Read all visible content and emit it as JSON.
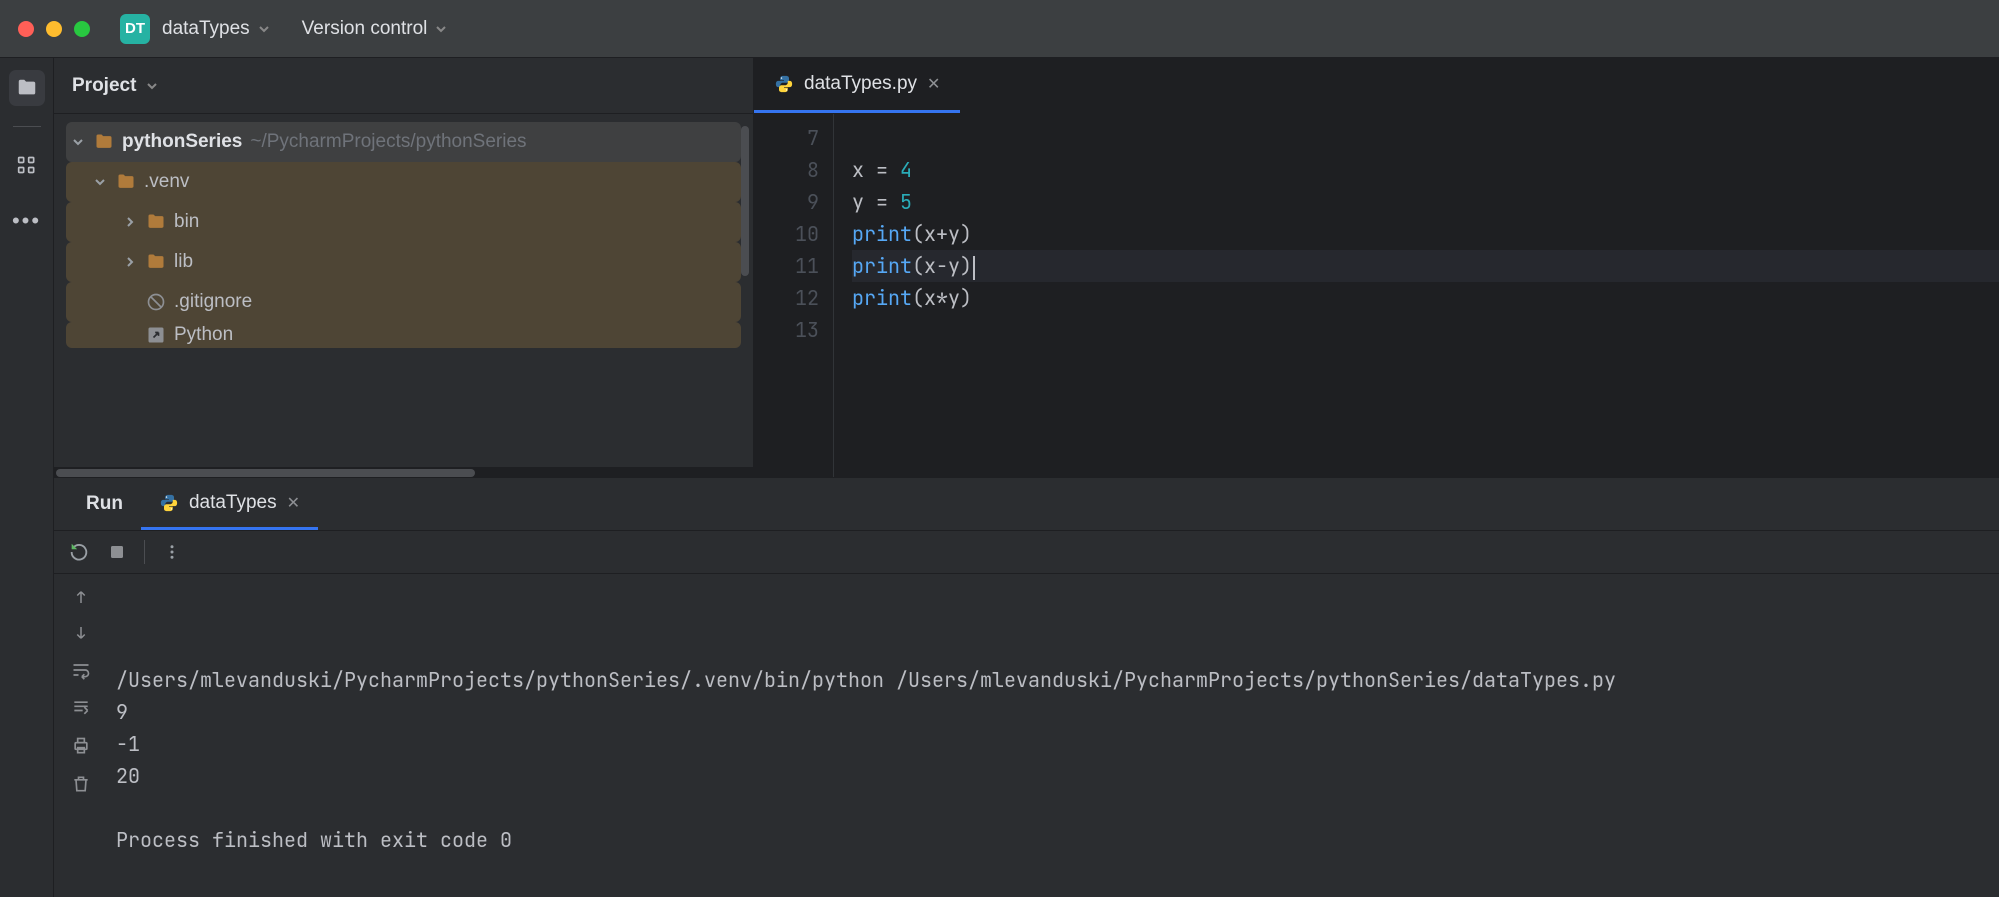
{
  "titlebar": {
    "badge_text": "DT",
    "project_name": "dataTypes",
    "menu_version_control": "Version control"
  },
  "toolstrip": {
    "items": [
      "project-tool",
      "structure-tool",
      "more-tool"
    ]
  },
  "project_panel": {
    "title": "Project",
    "tree": {
      "root_name": "pythonSeries",
      "root_path": "~/PycharmProjects/pythonSeries",
      "items": [
        {
          "name": ".venv",
          "kind": "folder",
          "level": 1,
          "expanded": true
        },
        {
          "name": "bin",
          "kind": "folder",
          "level": 2,
          "expanded": false
        },
        {
          "name": "lib",
          "kind": "folder",
          "level": 2,
          "expanded": false
        },
        {
          "name": ".gitignore",
          "kind": "ignore",
          "level": 2
        },
        {
          "name": "Python",
          "kind": "link",
          "level": 2,
          "cut": true
        }
      ]
    }
  },
  "editor": {
    "tab_filename": "dataTypes.py",
    "gutter_start": 7,
    "lines": [
      {
        "n": 7,
        "raw": ""
      },
      {
        "n": 8,
        "raw": "x = 4"
      },
      {
        "n": 9,
        "raw": "y = 5"
      },
      {
        "n": 10,
        "raw": "print(x+y)"
      },
      {
        "n": 11,
        "raw": "print(x-y)",
        "current": true
      },
      {
        "n": 12,
        "raw": "print(x*y)"
      },
      {
        "n": 13,
        "raw": ""
      }
    ]
  },
  "run_panel": {
    "head_label": "Run",
    "tab_label": "dataTypes",
    "output": [
      "/Users/mlevanduski/PycharmProjects/pythonSeries/.venv/bin/python /Users/mlevanduski/PycharmProjects/pythonSeries/dataTypes.py",
      "9",
      "-1",
      "20",
      "",
      "Process finished with exit code 0"
    ]
  }
}
